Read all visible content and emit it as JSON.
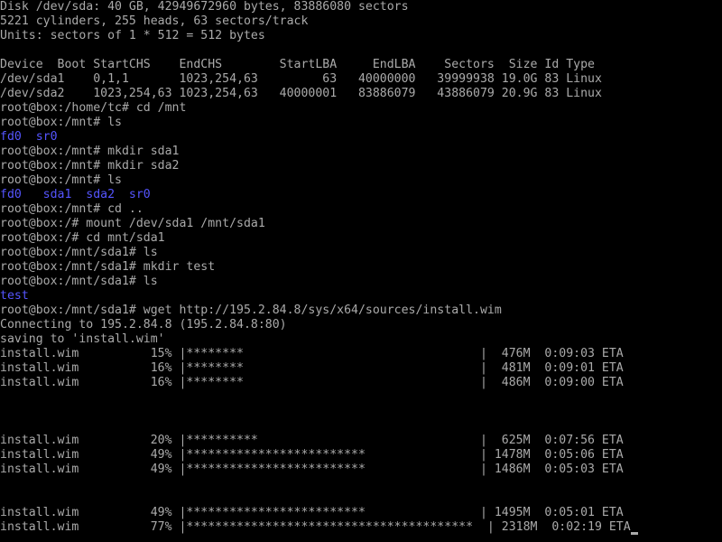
{
  "terminal": {
    "lines": [
      {
        "text": "Disk /dev/sda: 40 GB, 42949672960 bytes, 83886080 sectors",
        "kind": "output"
      },
      {
        "text": "5221 cylinders, 255 heads, 63 sectors/track",
        "kind": "output"
      },
      {
        "text": "Units: sectors of 1 * 512 = 512 bytes",
        "kind": "output"
      },
      {
        "text": "",
        "kind": "blank"
      },
      {
        "text": "Device  Boot StartCHS    EndCHS        StartLBA     EndLBA    Sectors  Size Id Type",
        "kind": "output"
      },
      {
        "text": "/dev/sda1    0,1,1       1023,254,63         63   40000000   39999938 19.0G 83 Linux",
        "kind": "output"
      },
      {
        "text": "/dev/sda2    1023,254,63 1023,254,63   40000001   83886079   43886079 20.9G 83 Linux",
        "kind": "output"
      },
      {
        "text": "root@box:/home/tc# cd /mnt",
        "kind": "command"
      },
      {
        "text": "root@box:/mnt# ls",
        "kind": "command"
      },
      {
        "text": "fd0  sr0",
        "kind": "listing"
      },
      {
        "text": "root@box:/mnt# mkdir sda1",
        "kind": "command"
      },
      {
        "text": "root@box:/mnt# mkdir sda2",
        "kind": "command"
      },
      {
        "text": "root@box:/mnt# ls",
        "kind": "command"
      },
      {
        "text": "fd0   sda1  sda2  sr0",
        "kind": "listing"
      },
      {
        "text": "root@box:/mnt# cd ..",
        "kind": "command"
      },
      {
        "text": "root@box:/# mount /dev/sda1 /mnt/sda1",
        "kind": "command"
      },
      {
        "text": "root@box:/# cd mnt/sda1",
        "kind": "command"
      },
      {
        "text": "root@box:/mnt/sda1# ls",
        "kind": "command"
      },
      {
        "text": "root@box:/mnt/sda1# mkdir test",
        "kind": "command"
      },
      {
        "text": "root@box:/mnt/sda1# ls",
        "kind": "command"
      },
      {
        "text": "test",
        "kind": "listing"
      },
      {
        "text": "root@box:/mnt/sda1# wget http://195.2.84.8/sys/x64/sources/install.wim",
        "kind": "command"
      },
      {
        "text": "Connecting to 195.2.84.8 (195.2.84.8:80)",
        "kind": "output"
      },
      {
        "text": "saving to 'install.wim'",
        "kind": "output"
      },
      {
        "text": "install.wim          15% |********                                 |  476M  0:09:03 ETA",
        "kind": "progress"
      },
      {
        "text": "install.wim          16% |********                                 |  481M  0:09:01 ETA",
        "kind": "progress"
      },
      {
        "text": "install.wim          16% |********                                 |  486M  0:09:00 ETA",
        "kind": "progress"
      },
      {
        "text": "",
        "kind": "blank"
      },
      {
        "text": "",
        "kind": "blank"
      },
      {
        "text": "",
        "kind": "blank"
      },
      {
        "text": "install.wim          20% |**********                               |  625M  0:07:56 ETA",
        "kind": "progress"
      },
      {
        "text": "install.wim          49% |*************************                | 1478M  0:05:06 ETA",
        "kind": "progress"
      },
      {
        "text": "install.wim          49% |*************************                | 1486M  0:05:03 ETA",
        "kind": "progress"
      },
      {
        "text": "",
        "kind": "blank"
      },
      {
        "text": "",
        "kind": "blank"
      },
      {
        "text": "install.wim          49% |*************************                | 1495M  0:05:01 ETA",
        "kind": "progress"
      },
      {
        "text": "install.wim          77% |****************************************  | 2318M  0:02:19 ETA",
        "kind": "progress",
        "cursor": true
      }
    ],
    "colors": {
      "background": "#000000",
      "foreground": "#aaaaaa",
      "listing": "#5555ff"
    }
  }
}
